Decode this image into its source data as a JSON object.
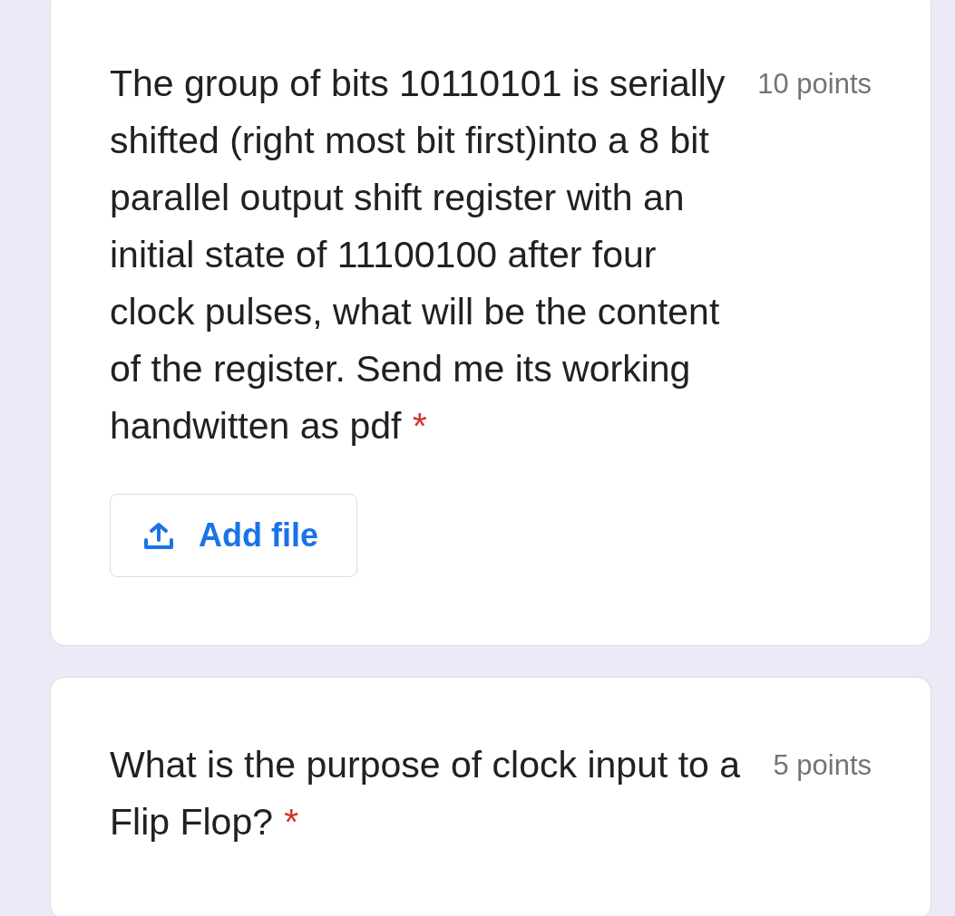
{
  "questions": [
    {
      "text": "The group of bits 10110101 is serially shifted (right most bit first)into a 8 bit parallel output shift register with an initial state of 11100100 after four clock pulses, what will be the content of the register. Send me its working handwitten as pdf",
      "required_mark": "*",
      "points": "10 points",
      "upload": {
        "label": "Add file"
      }
    },
    {
      "text": "What is the purpose of clock input to a Flip Flop?",
      "required_mark": "*",
      "points": "5 points"
    }
  ]
}
